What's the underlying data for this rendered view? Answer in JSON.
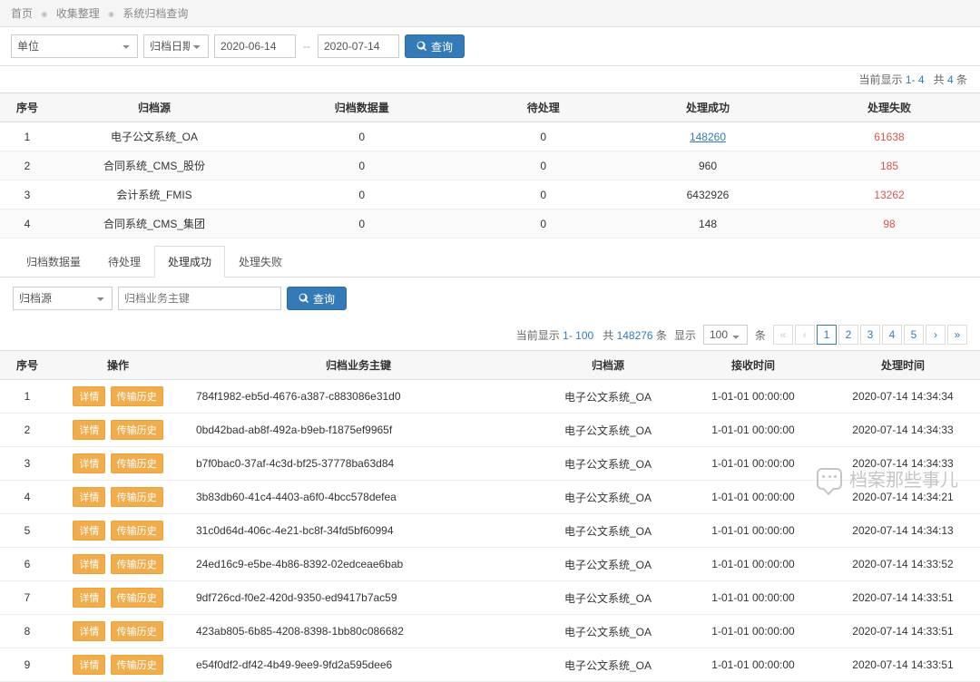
{
  "breadcrumb": {
    "home": "首页",
    "collect": "收集整理",
    "current": "系统归档查询"
  },
  "toolbar": {
    "unit_placeholder": "单位",
    "date_type": "归档日期",
    "date_from": "2020-06-14",
    "date_to": "2020-07-14",
    "query": "查询"
  },
  "summary": {
    "prefix": "当前显示",
    "range": "1- 4",
    "mid": "共",
    "total": "4",
    "suffix": "条"
  },
  "top_table": {
    "headers": {
      "idx": "序号",
      "source": "归档源",
      "count": "归档数据量",
      "pending": "待处理",
      "success": "处理成功",
      "fail": "处理失败"
    },
    "rows": [
      {
        "idx": "1",
        "source": "电子公文系统_OA",
        "count": "0",
        "pending": "0",
        "success": "148260",
        "fail": "61638",
        "success_link": true
      },
      {
        "idx": "2",
        "source": "合同系统_CMS_股份",
        "count": "0",
        "pending": "0",
        "success": "960",
        "fail": "185"
      },
      {
        "idx": "3",
        "source": "会计系统_FMIS",
        "count": "0",
        "pending": "0",
        "success": "6432926",
        "fail": "13262"
      },
      {
        "idx": "4",
        "source": "合同系统_CMS_集团",
        "count": "0",
        "pending": "0",
        "success": "148",
        "fail": "98"
      }
    ]
  },
  "tabs": {
    "items": [
      "归档数据量",
      "待处理",
      "处理成功",
      "处理失败"
    ],
    "active": 2
  },
  "subtoolbar": {
    "source_placeholder": "归档源",
    "key_placeholder": "归档业务主键",
    "query": "查询"
  },
  "list_summary": {
    "prefix": "当前显示",
    "range": "1- 100",
    "mid": "共",
    "total": "148276",
    "suffix": "条",
    "show": "显示",
    "page_size": "100",
    "page_size_unit": "条",
    "pages": [
      "1",
      "2",
      "3",
      "4",
      "5"
    ],
    "current": "1"
  },
  "detail_table": {
    "headers": {
      "idx": "序号",
      "op": "操作",
      "key": "归档业务主键",
      "source": "归档源",
      "recv": "接收时间",
      "proc": "处理时间"
    },
    "btn_detail": "详情",
    "btn_history": "传输历史",
    "rows": [
      {
        "idx": "1",
        "key": "784f1982-eb5d-4676-a387-c883086e31d0",
        "source": "电子公文系统_OA",
        "recv": "1-01-01 00:00:00",
        "proc": "2020-07-14 14:34:34"
      },
      {
        "idx": "2",
        "key": "0bd42bad-ab8f-492a-b9eb-f1875ef9965f",
        "source": "电子公文系统_OA",
        "recv": "1-01-01 00:00:00",
        "proc": "2020-07-14 14:34:33"
      },
      {
        "idx": "3",
        "key": "b7f0bac0-37af-4c3d-bf25-37778ba63d84",
        "source": "电子公文系统_OA",
        "recv": "1-01-01 00:00:00",
        "proc": "2020-07-14 14:34:33"
      },
      {
        "idx": "4",
        "key": "3b83db60-41c4-4403-a6f0-4bcc578defea",
        "source": "电子公文系统_OA",
        "recv": "1-01-01 00:00:00",
        "proc": "2020-07-14 14:34:21"
      },
      {
        "idx": "5",
        "key": "31c0d64d-406c-4e21-bc8f-34fd5bf60994",
        "source": "电子公文系统_OA",
        "recv": "1-01-01 00:00:00",
        "proc": "2020-07-14 14:34:13"
      },
      {
        "idx": "6",
        "key": "24ed16c9-e5be-4b86-8392-02edceae6bab",
        "source": "电子公文系统_OA",
        "recv": "1-01-01 00:00:00",
        "proc": "2020-07-14 14:33:52"
      },
      {
        "idx": "7",
        "key": "9df726cd-f0e2-420d-9350-ed9417b7ac59",
        "source": "电子公文系统_OA",
        "recv": "1-01-01 00:00:00",
        "proc": "2020-07-14 14:33:51"
      },
      {
        "idx": "8",
        "key": "423ab805-6b85-4208-8398-1bb80c086682",
        "source": "电子公文系统_OA",
        "recv": "1-01-01 00:00:00",
        "proc": "2020-07-14 14:33:51"
      },
      {
        "idx": "9",
        "key": "e54f0df2-df42-4b49-9ee9-9fd2a595dee6",
        "source": "电子公文系统_OA",
        "recv": "1-01-01 00:00:00",
        "proc": "2020-07-14 14:33:51"
      }
    ]
  },
  "watermark": "档案那些事儿"
}
